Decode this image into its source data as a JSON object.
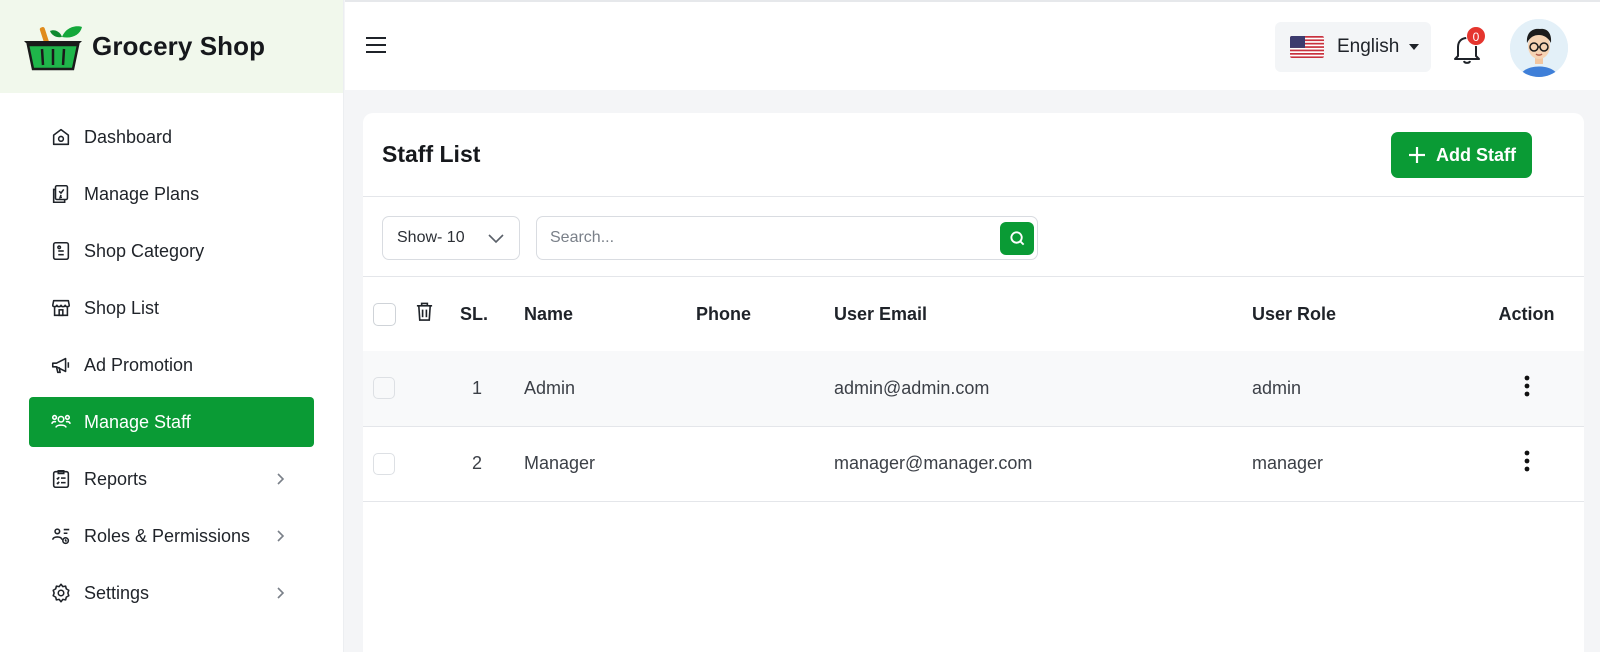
{
  "brand": {
    "name": "Grocery Shop"
  },
  "sidebar": {
    "items": [
      {
        "label": "Dashboard",
        "icon": "home-icon",
        "active": false,
        "has_submenu": false
      },
      {
        "label": "Manage Plans",
        "icon": "plans-icon",
        "active": false,
        "has_submenu": false
      },
      {
        "label": "Shop Category",
        "icon": "category-icon",
        "active": false,
        "has_submenu": false
      },
      {
        "label": "Shop List",
        "icon": "store-icon",
        "active": false,
        "has_submenu": false
      },
      {
        "label": "Ad Promotion",
        "icon": "megaphone-icon",
        "active": false,
        "has_submenu": false
      },
      {
        "label": "Manage Staff",
        "icon": "staff-icon",
        "active": true,
        "has_submenu": false
      },
      {
        "label": "Reports",
        "icon": "reports-icon",
        "active": false,
        "has_submenu": true
      },
      {
        "label": "Roles & Permissions",
        "icon": "roles-icon",
        "active": false,
        "has_submenu": true
      },
      {
        "label": "Settings",
        "icon": "gear-icon",
        "active": false,
        "has_submenu": true
      }
    ]
  },
  "topbar": {
    "language": "English",
    "language_flag": "us-flag-icon",
    "notification_count": "0"
  },
  "page": {
    "title": "Staff List",
    "add_button_label": "Add Staff",
    "show_select": "Show- 10",
    "search_placeholder": "Search..."
  },
  "table": {
    "columns": [
      "SL.",
      "Name",
      "Phone",
      "User Email",
      "User Role",
      "Action"
    ],
    "rows": [
      {
        "sl": "1",
        "name": "Admin",
        "phone": "",
        "email": "admin@admin.com",
        "role": "admin"
      },
      {
        "sl": "2",
        "name": "Manager",
        "phone": "",
        "email": "manager@manager.com",
        "role": "manager"
      }
    ]
  },
  "colors": {
    "accent": "#0a9b35",
    "brand_bg": "#f1f8ec",
    "badge": "#e5352e"
  }
}
